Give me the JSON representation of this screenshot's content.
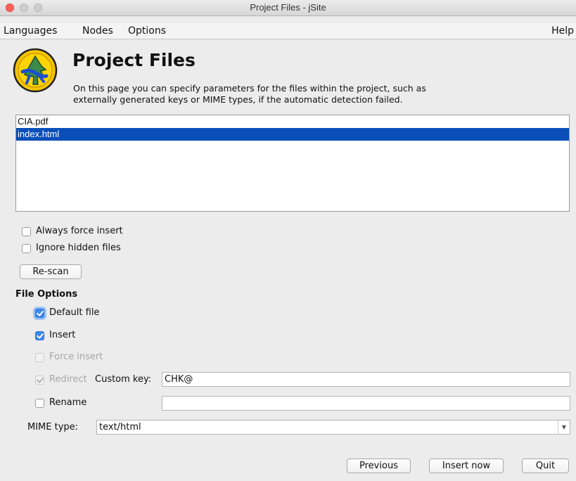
{
  "window": {
    "title": "Project Files - jSite"
  },
  "menu": {
    "languages": "Languages",
    "nodes": "Nodes",
    "options": "Options",
    "help": "Help"
  },
  "header": {
    "title": "Project Files",
    "description_line1": "On this page you can specify parameters for the files within the project, such as",
    "description_line2": "externally generated keys or MIME types, if the automatic detection failed.",
    "logo_icon": "jsite-logo-icon"
  },
  "files": [
    {
      "name": "CIA.pdf",
      "selected": false
    },
    {
      "name": "index.html",
      "selected": true
    }
  ],
  "project_options": {
    "always_force_insert": {
      "label": "Always force insert",
      "checked": false
    },
    "ignore_hidden_files": {
      "label": "Ignore hidden files",
      "checked": false
    },
    "rescan_label": "Re-scan"
  },
  "file_options": {
    "title": "File Options",
    "default_file": {
      "label": "Default file",
      "checked": true
    },
    "insert": {
      "label": "Insert",
      "checked": true
    },
    "force_insert": {
      "label": "Force insert",
      "checked": false,
      "enabled": false
    },
    "redirect": {
      "label": "Redirect",
      "checked": true,
      "enabled": false
    },
    "custom_key_label": "Custom key:",
    "custom_key_value": "CHK@",
    "rename": {
      "label": "Rename",
      "checked": false
    },
    "rename_value": "",
    "mime_label": "MIME type:",
    "mime_value": "text/html"
  },
  "buttons": {
    "previous": "Previous",
    "insert_now": "Insert now",
    "quit": "Quit"
  },
  "colors": {
    "selection": "#0a4fb9",
    "checkbox_checked": "#3d88f2",
    "close_button": "#fc605c"
  }
}
